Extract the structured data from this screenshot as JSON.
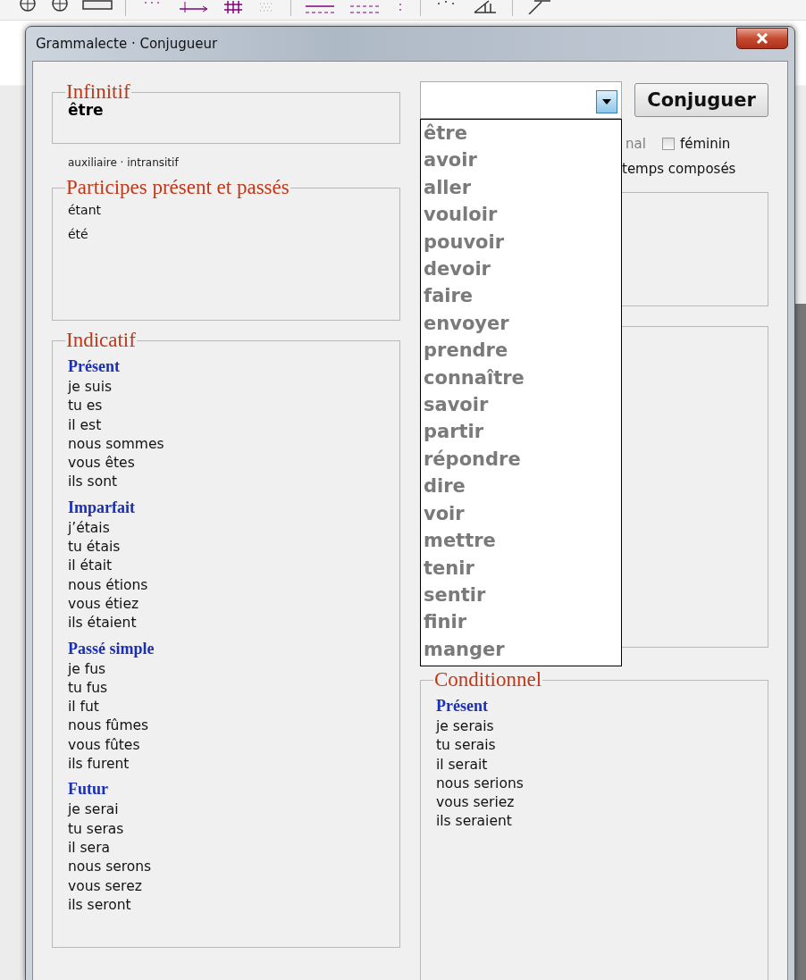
{
  "window": {
    "title": "Grammalecte · Conjugueur"
  },
  "infinitive": {
    "legend": "Infinitif",
    "verb": "être"
  },
  "verb_info": "auxiliaire · intransitif",
  "participles": {
    "legend": "Participes présent et passés",
    "items": [
      "étant",
      "été"
    ]
  },
  "indicative": {
    "legend": "Indicatif",
    "tenses": [
      {
        "name": "Présent",
        "forms": [
          "je suis",
          "tu es",
          "il est",
          "nous sommes",
          "vous êtes",
          "ils sont"
        ]
      },
      {
        "name": "Imparfait",
        "forms": [
          "j’étais",
          "tu étais",
          "il était",
          "nous étions",
          "vous étiez",
          "ils étaient"
        ]
      },
      {
        "name": "Passé simple",
        "forms": [
          "je fus",
          "tu fus",
          "il fut",
          "nous fûmes",
          "vous fûtes",
          "ils furent"
        ]
      },
      {
        "name": "Futur",
        "forms": [
          "je serai",
          "tu seras",
          "il sera",
          "nous serons",
          "vous serez",
          "ils seront"
        ]
      }
    ]
  },
  "verb_combo": {
    "expanded": true,
    "options": [
      "être",
      "avoir",
      "aller",
      "vouloir",
      "pouvoir",
      "devoir",
      "faire",
      "envoyer",
      "prendre",
      "connaître",
      "savoir",
      "partir",
      "répondre",
      "dire",
      "voir",
      "mettre",
      "tenir",
      "sentir",
      "finir",
      "manger"
    ]
  },
  "conjugate_button": "Conjuguer",
  "pronominal_fragment": {
    "label": "nal",
    "disabled": true
  },
  "feminine": {
    "label": "féminin",
    "checked": false
  },
  "compound_tenses": {
    "label": "temps composés"
  },
  "conditional": {
    "legend": "Conditionnel",
    "tenses": [
      {
        "name": "Présent",
        "forms": [
          "je serais",
          "tu serais",
          "il serait",
          "nous serions",
          "vous seriez",
          "ils seraient"
        ]
      }
    ]
  }
}
